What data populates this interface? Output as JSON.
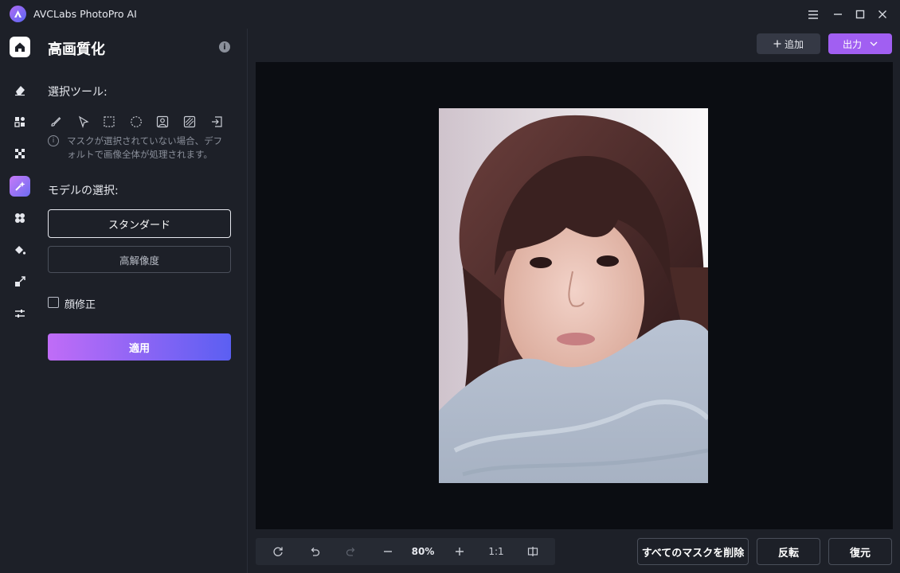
{
  "app": {
    "title": "AVCLabs PhotoPro AI",
    "accent_color": "#a15ff2"
  },
  "window_controls": [
    {
      "name": "menu-icon"
    },
    {
      "name": "minimize-icon"
    },
    {
      "name": "maximize-icon"
    },
    {
      "name": "close-icon"
    }
  ],
  "sidebar": {
    "items": [
      {
        "name": "home-icon",
        "state": "home"
      },
      {
        "name": "eraser-icon"
      },
      {
        "name": "shapes-icon"
      },
      {
        "name": "focus-icon"
      },
      {
        "name": "enhance-icon",
        "state": "active"
      },
      {
        "name": "fan-icon"
      },
      {
        "name": "paint-bucket-icon"
      },
      {
        "name": "resize-icon"
      },
      {
        "name": "adjust-sliders-icon"
      }
    ]
  },
  "panel": {
    "title": "高画質化",
    "selection_tools_label": "選択ツール:",
    "tools": [
      {
        "name": "brush-tool-icon"
      },
      {
        "name": "arrow-select-tool-icon"
      },
      {
        "name": "rect-select-tool-icon"
      },
      {
        "name": "ellipse-select-tool-icon"
      },
      {
        "name": "portrait-select-tool-icon"
      },
      {
        "name": "object-select-tool-icon"
      },
      {
        "name": "import-mask-tool-icon"
      }
    ],
    "hint": "マスクが選択されていない場合、デフォルトで画像全体が処理されます。",
    "model_label": "モデルの選択:",
    "models": [
      {
        "label": "スタンダード",
        "selected": true
      },
      {
        "label": "高解像度",
        "selected": false
      }
    ],
    "face_fix_label": "顔修正",
    "face_fix_checked": false,
    "apply_label": "適用"
  },
  "header": {
    "add_label": "追加",
    "export_label": "出力"
  },
  "zoom": {
    "value": "80%",
    "actual_size_label": "1:1"
  },
  "actions": {
    "delete_masks_label": "すべてのマスクを削除",
    "invert_label": "反転",
    "restore_label": "復元"
  }
}
